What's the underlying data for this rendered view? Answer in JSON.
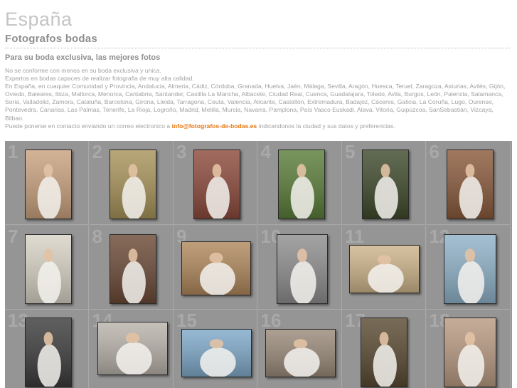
{
  "header": {
    "brand": "España",
    "subtitle": "Fotografos bodas",
    "tagline": "Para su boda exclusiva, las mejores fotos"
  },
  "intro": {
    "line1": "No se conforme con menos en su boda exclusiva y unica.",
    "line2": "Expertos en bodas capaces de realizar fotografia de muy alta calidad.",
    "line3": "En España, en cuaquier Comunidad y Provincia, Andalucia, Almeria, Cádiz, Córdoba, Granada, Huelva, Jaén, Málaga, Sevilla, Aragón, Huesca, Teruel, Zaragoza, Asturias, Avilés, Gijón, Oviedo, Baleares, Ibiza, Mallorca, Menorca, Cantabria, Santander, Castilla La Mancha, Albacete, Ciudad Real, Cuenca, Guadalajara, Toledo, Avila, Burgos, León, Palencia, Salamanca, Soria, Valladolid, Zamora, Cataluña, Barcelona, Girona, Lleida, Tarragona, Ceuta, Valencia, Alicante, Castellón, Extremadura, Badajóz, Cáceres, Galicia, La Coruña, Lugo, Ourense, Pontevedra, Canarias, Las Palmas, Tenerife, La Rioja, Logroño, Madrid, Melilla, Murcia, Navarra, Pamplona, País Vasco Euskadi, Alava, Vitoria, Guipúzcoa, SanSebastián, Vizcaya, Bilbao.",
    "contact_prefix": "Puede ponerse en contacto enviando un correo electronico a",
    "contact_email": "info@fotografos-de-bodas.es",
    "contact_suffix": "indicandonos la ciudad y sus datos y preferencias."
  },
  "gallery": {
    "items": [
      {
        "num": "1",
        "tone": "#c9a27f"
      },
      {
        "num": "2",
        "tone": "#a8935a"
      },
      {
        "num": "3",
        "tone": "#8c4a3c"
      },
      {
        "num": "4",
        "tone": "#5b7d3a"
      },
      {
        "num": "5",
        "tone": "#3f4a2c"
      },
      {
        "num": "6",
        "tone": "#8a5a3c"
      },
      {
        "num": "7",
        "tone": "#d8d3c6"
      },
      {
        "num": "8",
        "tone": "#6b4a36"
      },
      {
        "num": "9",
        "tone": "#b0885c"
      },
      {
        "num": "10",
        "tone": "#8e8e8e"
      },
      {
        "num": "11",
        "tone": "#cdb48a"
      },
      {
        "num": "12",
        "tone": "#8fb2c8"
      },
      {
        "num": "13",
        "tone": "#3c3c3c"
      },
      {
        "num": "14",
        "tone": "#b9b3aa"
      },
      {
        "num": "15",
        "tone": "#7fa9c9"
      },
      {
        "num": "16",
        "tone": "#9a8a7a"
      },
      {
        "num": "17",
        "tone": "#5a4a32"
      },
      {
        "num": "18",
        "tone": "#b89a82"
      }
    ]
  }
}
